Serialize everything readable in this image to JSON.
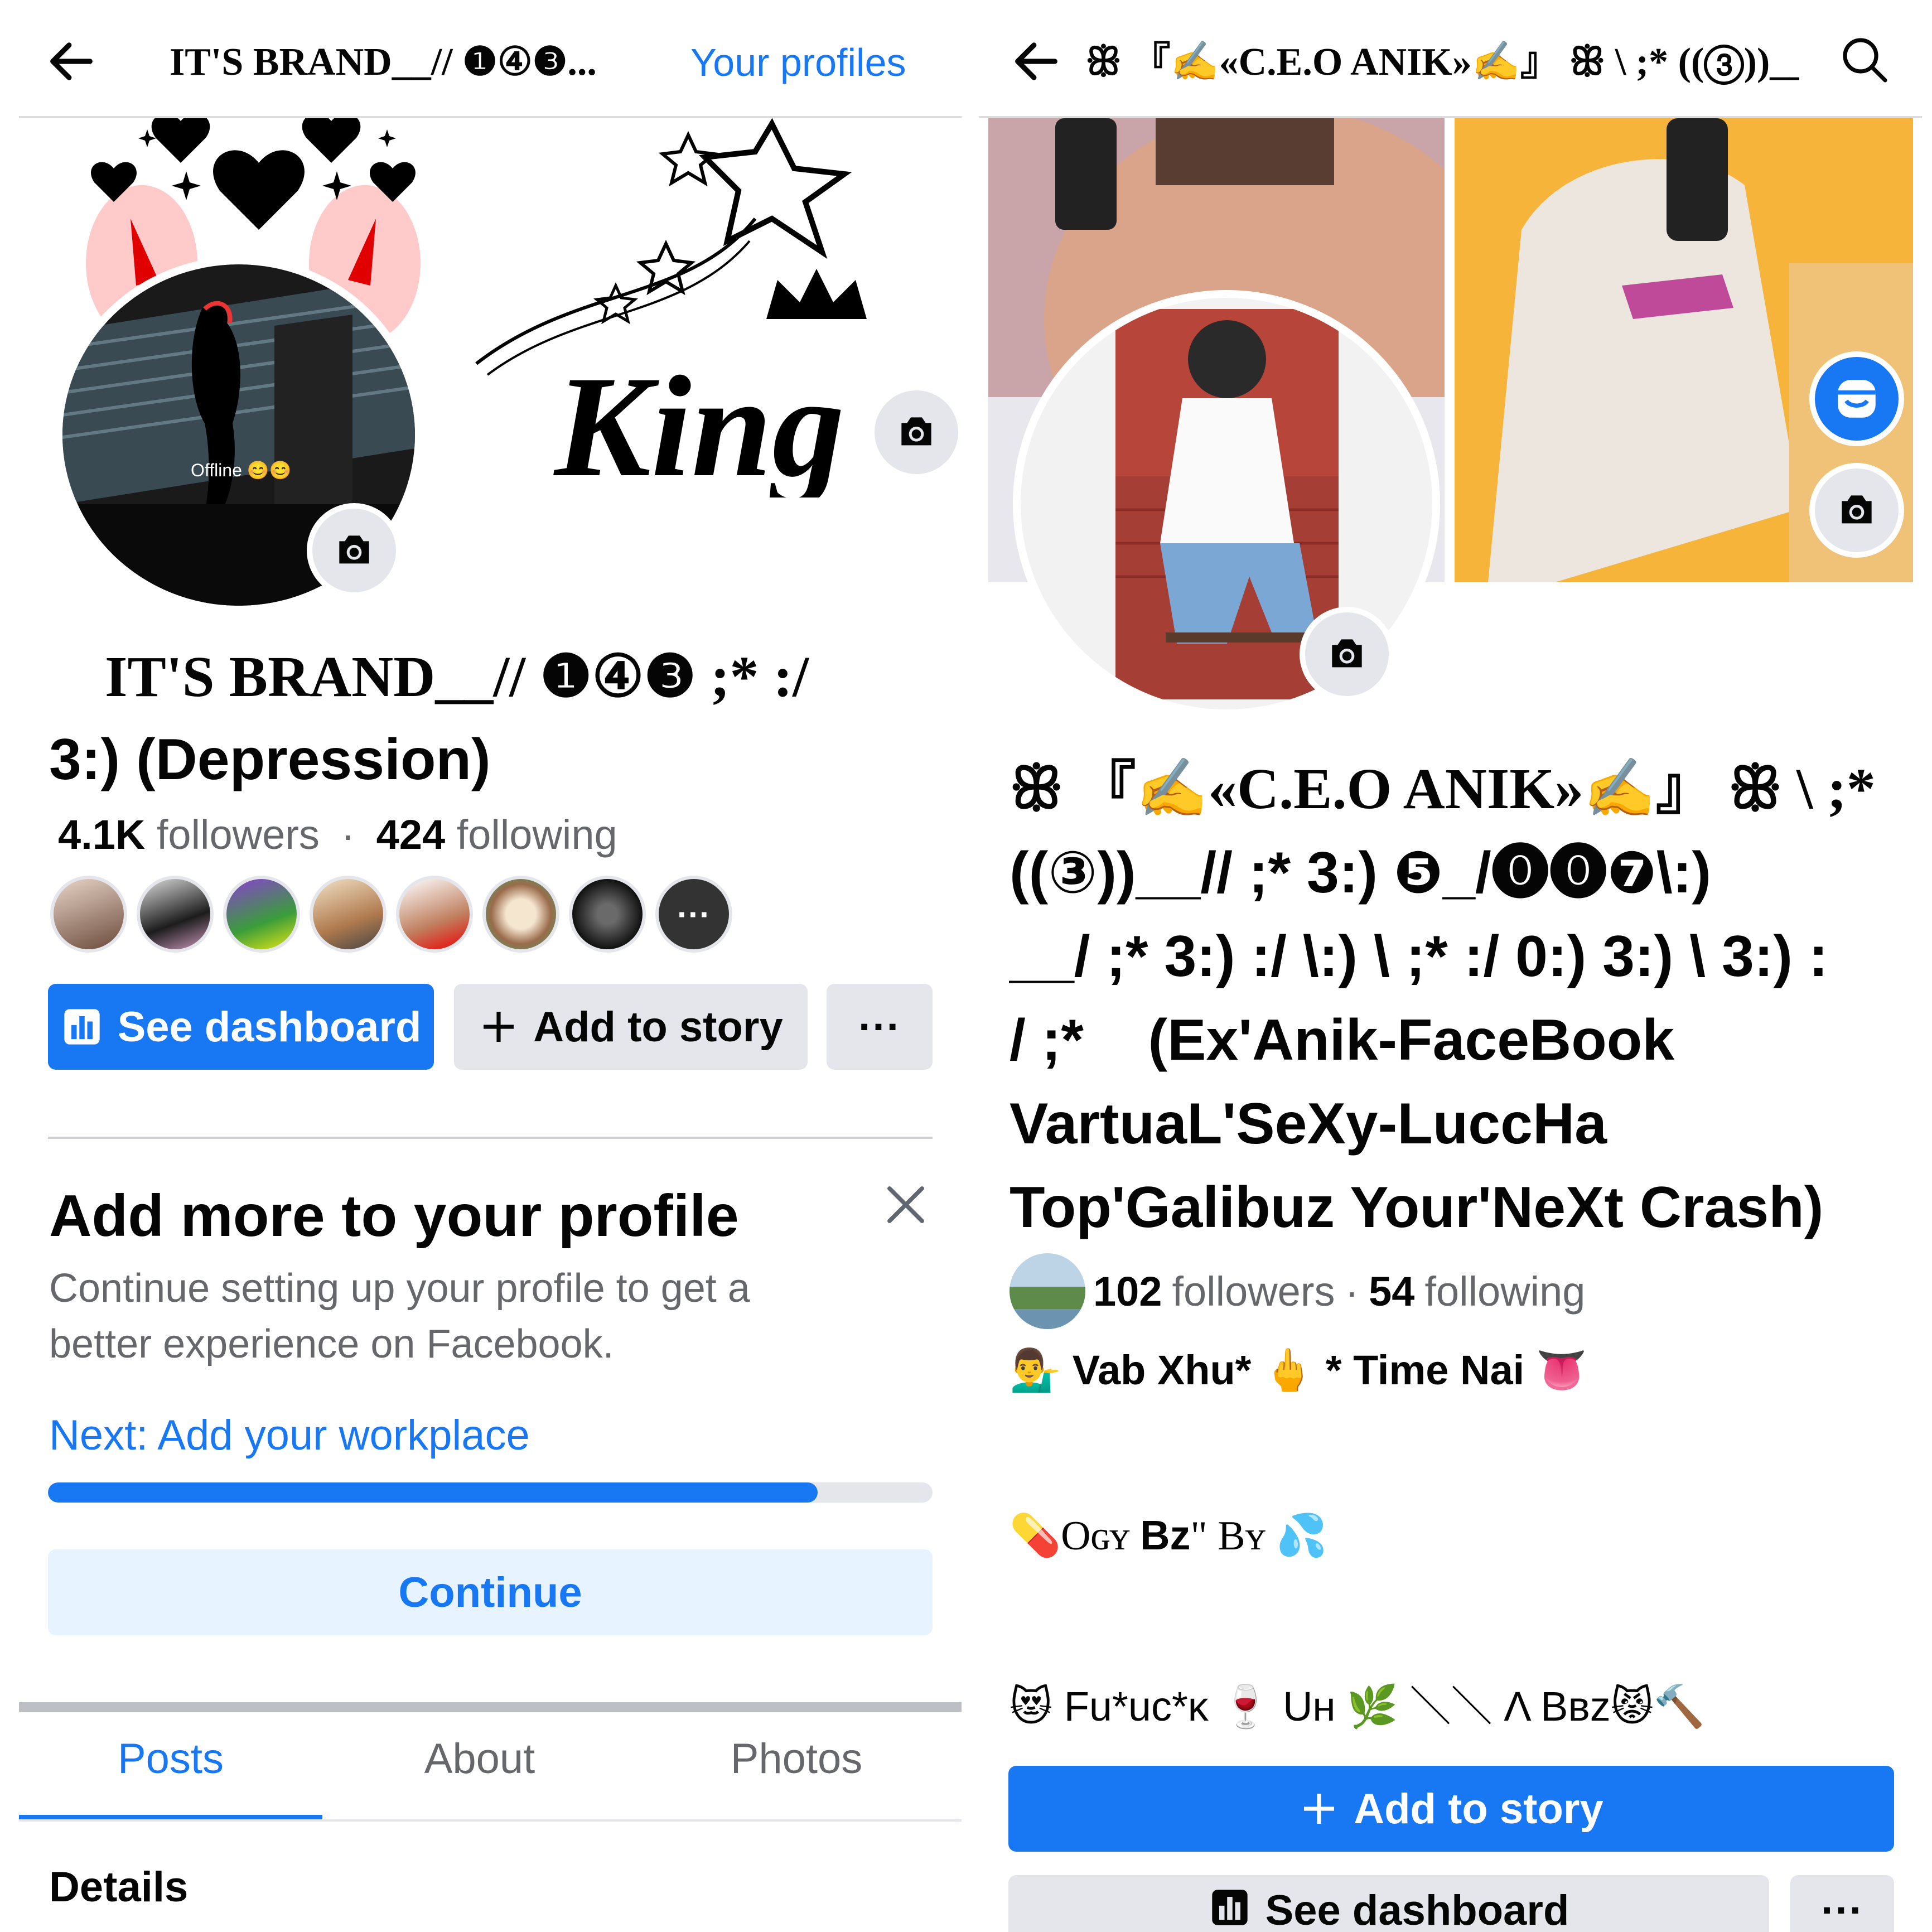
{
  "left": {
    "topbar": {
      "title": "IT'S BRAND__// ❶④❸...",
      "your_profiles": "Your profiles"
    },
    "avatar_caption": "Offline 😊😊",
    "cover_text": "King",
    "name": {
      "line1": "IT'S BRAND__// ❶④❸ ;* :/",
      "line2": "3:) (Depression)"
    },
    "stats": {
      "followers_count": "4.1K",
      "followers_label": "followers",
      "dot": "·",
      "following_count": "424",
      "following_label": "following"
    },
    "more_friends": "···",
    "buttons": {
      "dashboard": "See dashboard",
      "add_story": "Add to story",
      "more": "···"
    },
    "card": {
      "title": "Add more to your profile",
      "description": "Continue setting up your profile to get a better experience on Facebook.",
      "next": "Next: Add your workplace",
      "progress": 0.87,
      "continue": "Continue"
    },
    "tabs": [
      "Posts",
      "About",
      "Photos"
    ],
    "details": "Details"
  },
  "right": {
    "topbar": {
      "title": "ꕥ 『✍«C.E.O ANIK»✍』 ꕥ \\ ;* ((③))__..."
    },
    "name": {
      "line1": "ꕥ 『✍«C.E.O ANIK»✍』 ꕥ \\ ;*",
      "line2": "((③))__// ;* 3:) ❺_/⓿⓿❼\\:)",
      "line3": "__/ ;* 3:) :/ \\:) \\ ;* :/ 0:) 3:) \\ 3:) :",
      "line4": "/ ;*    (Ex'Anik-FaceBook",
      "line5": "VartuaL'SeXy-LuccHa",
      "line6": "Top'Galibuz Your'NeXt Crash)"
    },
    "stats": {
      "followers_count": "102",
      "followers_label": "followers",
      "dot": "·",
      "following_count": "54",
      "following_label": "following"
    },
    "bio": {
      "line1": "💁‍♂️ Vab Xhu* 🖕 * Time Nai 👅",
      "line2_a": "💊Oɢʏ ",
      "line2_b": "Bz",
      "line2_c": "\" Bʏ 💦",
      "line3": "😻 Fu*uc*ᴋ 🍷 Uʜ 🌿 ＼＼ Λ Bʙz😾🔨"
    },
    "buttons": {
      "add_story": "Add to story",
      "dashboard": "See dashboard",
      "more": "···"
    }
  },
  "colors": {
    "accent": "#1877f2",
    "grey_button": "#e4e6eb",
    "light_blue": "#e7f3ff",
    "secondary_text": "#65676b"
  }
}
